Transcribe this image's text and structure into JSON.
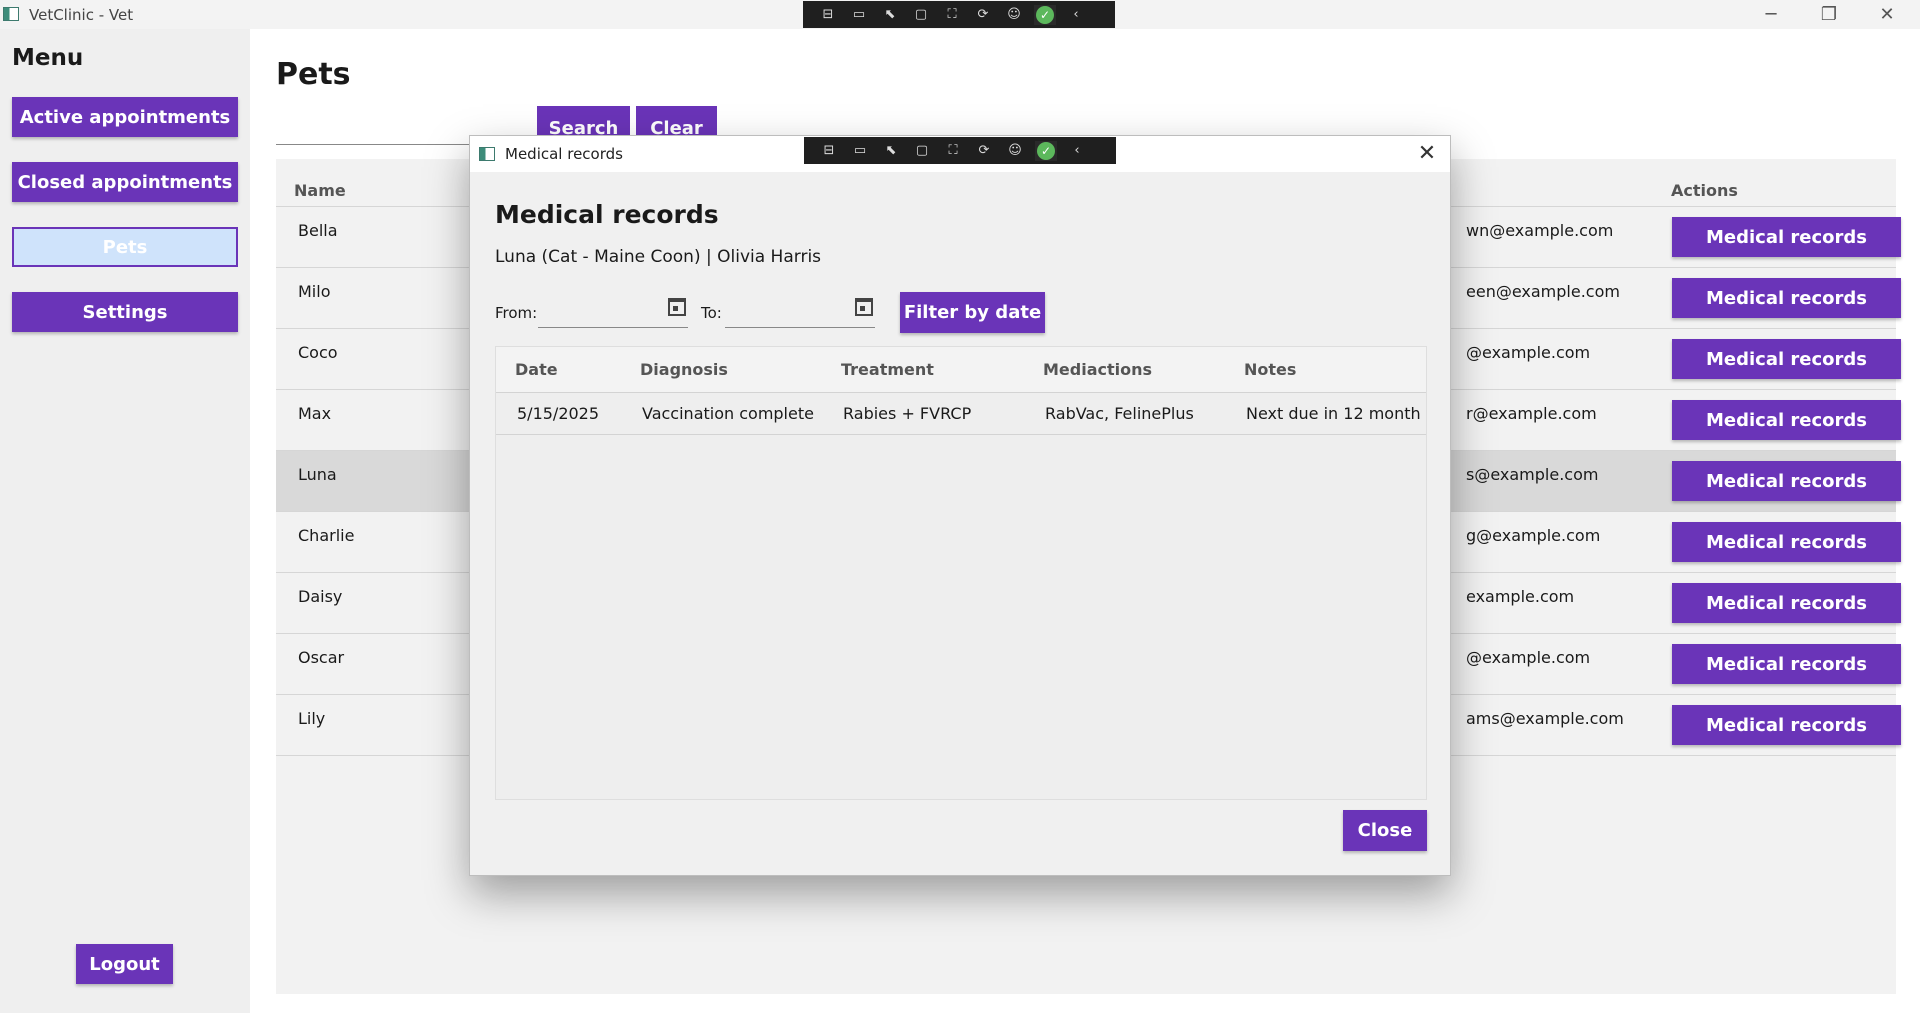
{
  "window": {
    "title": "VetClinic - Vet",
    "controls": {
      "minimize": "─",
      "maximize": "❐",
      "close": "✕"
    }
  },
  "debug_toolbar": {
    "icons": [
      "live-tree-icon",
      "video-icon",
      "select-element-icon",
      "display-layout-adorners-icon",
      "track-focus-icon",
      "hot-reload-icon",
      "accessibility-icon",
      "binding-ok-icon",
      "collapse-icon"
    ],
    "glyphs": [
      "⊟",
      "▭",
      "⬉",
      "▢",
      "⛶",
      "⟳",
      "☺",
      "✓",
      "‹"
    ]
  },
  "sidebar": {
    "title": "Menu",
    "items": [
      {
        "label": "Active appointments"
      },
      {
        "label": "Closed appointments"
      },
      {
        "label": "Pets"
      },
      {
        "label": "Settings"
      }
    ],
    "logout_label": "Logout"
  },
  "main": {
    "title": "Pets",
    "search": {
      "value": "",
      "placeholder": ""
    },
    "search_label": "Search",
    "clear_label": "Clear",
    "columns": {
      "name": "Name",
      "actions": "Actions"
    },
    "rows": [
      {
        "name": "Bella",
        "email": "wn@example.com",
        "action": "Medical records"
      },
      {
        "name": "Milo",
        "email": "een@example.com",
        "action": "Medical records"
      },
      {
        "name": "Coco",
        "email": "@example.com",
        "action": "Medical records"
      },
      {
        "name": "Max",
        "email": "r@example.com",
        "action": "Medical records"
      },
      {
        "name": "Luna",
        "email": "s@example.com",
        "action": "Medical records"
      },
      {
        "name": "Charlie",
        "email": "g@example.com",
        "action": "Medical records"
      },
      {
        "name": "Daisy",
        "email": "example.com",
        "action": "Medical records"
      },
      {
        "name": "Oscar",
        "email": "@example.com",
        "action": "Medical records"
      },
      {
        "name": "Lily",
        "email": "ams@example.com",
        "action": "Medical records"
      }
    ]
  },
  "dialog": {
    "window_title": "Medical records",
    "close_glyph": "✕",
    "heading": "Medical records",
    "subtitle": "Luna (Cat - Maine Coon) | Olivia Harris",
    "from_label": "From:",
    "to_label": "To:",
    "from_value": "",
    "to_value": "",
    "filter_label": "Filter by date",
    "columns": [
      "Date",
      "Diagnosis",
      "Treatment",
      "Mediactions",
      "Notes"
    ],
    "records": [
      {
        "date": "5/15/2025",
        "diagnosis": "Vaccination complete",
        "treatment": "Rabies + FVRCP",
        "medications": "RabVac, FelinePlus",
        "notes": "Next due in 12 month"
      }
    ],
    "close_label": "Close"
  },
  "colors": {
    "accent": "#6a34b8",
    "selected_nav_bg": "#cfe3fb",
    "selected_row_bg": "#d9d9d9",
    "sidebar_bg": "#efefef"
  }
}
